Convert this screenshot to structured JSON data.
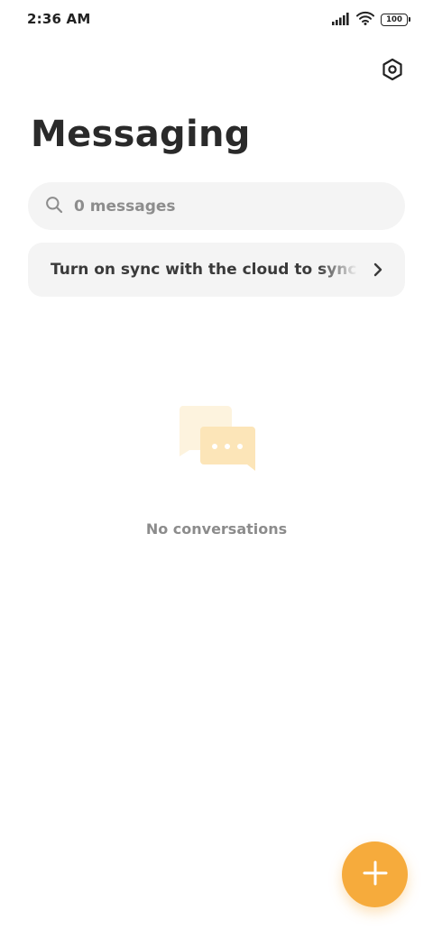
{
  "status_bar": {
    "time": "2:36 AM",
    "battery_level": "100",
    "icons": [
      "signal-icon",
      "wifi-icon",
      "battery-icon"
    ]
  },
  "header": {
    "title": "Messaging",
    "settings_icon": "settings-hexagon-icon"
  },
  "search": {
    "placeholder": "0 messages",
    "icon": "search-icon"
  },
  "sync_banner": {
    "text": "Turn on sync with the cloud to sync messages",
    "icon": "chevron-right-icon"
  },
  "empty_state": {
    "icon": "chat-bubbles-icon",
    "text": "No conversations"
  },
  "fab": {
    "icon": "plus-icon"
  },
  "colors": {
    "accent": "#f6ab3c",
    "bubble_light": "#fdf3de",
    "bubble_dark": "#fce5b8",
    "surface": "#f4f4f4"
  }
}
